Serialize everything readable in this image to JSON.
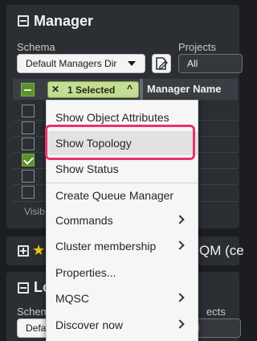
{
  "manager_panel": {
    "title": "Manager",
    "schema_label": "Schema",
    "schema_value": "Default Managers Dir",
    "projects_label": "Projects",
    "projects_value": "All"
  },
  "table": {
    "selected_chip": "1 Selected",
    "column_header": "Manager Name",
    "rows": [
      {
        "checked": false
      },
      {
        "checked": false
      },
      {
        "checked": false
      },
      {
        "checked": true
      },
      {
        "checked": false
      },
      {
        "checked": false
      }
    ],
    "visible_text": "Visib"
  },
  "favorite_panel": {
    "title_fragment": "QM (ce"
  },
  "local_panel": {
    "title_fragment": "Lo",
    "schema_label_fragment": "Schema",
    "schema_value_fragment": "Defa",
    "projects_label_fragment": "ects",
    "projects_value_fragment": "ll"
  },
  "context_menu": {
    "items": [
      {
        "label": "Show Object Attributes",
        "submenu": false
      },
      {
        "label": "Show Topology",
        "submenu": false,
        "highlighted": true
      },
      {
        "label": "Show Status",
        "submenu": false
      },
      {
        "label": "Create Queue Manager",
        "submenu": false
      },
      {
        "label": "Commands",
        "submenu": true
      },
      {
        "label": "Cluster membership",
        "submenu": true
      },
      {
        "label": "Properties...",
        "submenu": false
      },
      {
        "label": "MQSC",
        "submenu": true
      },
      {
        "label": "Discover now",
        "submenu": true
      }
    ]
  },
  "colors": {
    "accent_green": "#5c8f2b",
    "chip_green": "#c6dd96",
    "focus_pink": "#e8336a",
    "panel_bg": "#2b2e33"
  }
}
